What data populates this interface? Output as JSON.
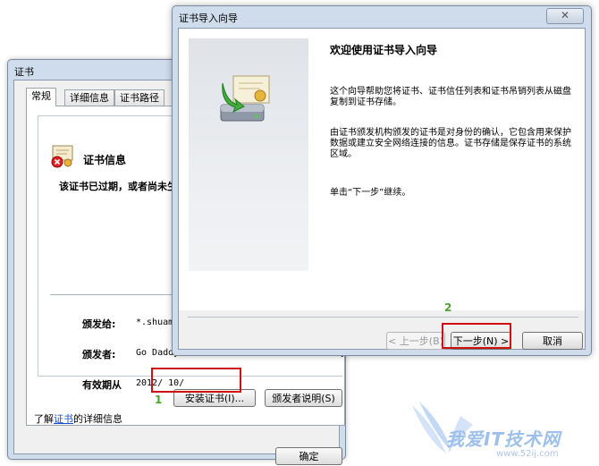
{
  "cert_dialog": {
    "title": "证书",
    "tabs": [
      "常规",
      "详细信息",
      "证书路径"
    ],
    "info_title": "证书信息",
    "expired_message": "该证书已过期，或者尚未生效。",
    "fields": [
      {
        "label": "颁发给:",
        "value": "*.shuame.com"
      },
      {
        "label": "颁发者:",
        "value": "Go Daddy Secure Certification Authority"
      },
      {
        "label": "有效期从",
        "value": "2012/ 10/"
      }
    ],
    "install_button": "安装证书(I)...",
    "issuer_button": "颁发者说明(S)",
    "learn_prefix": "了解",
    "learn_link": "证书",
    "learn_suffix": "的详细信息",
    "ok_button": "确定"
  },
  "wizard": {
    "title": "证书导入向导",
    "close_symbol": "✕",
    "heading": "欢迎使用证书导入向导",
    "para1": "这个向导帮助您将证书、证书信任列表和证书吊销列表从磁盘复制到证书存储。",
    "para2": "由证书颁发机构颁发的证书是对身份的确认，它包含用来保护数据或建立安全网络连接的信息。证书存储是保存证书的系统区域。",
    "para3": "单击“下一步”继续。",
    "back_button": "< 上一步(B)",
    "next_button": "下一步(N) >",
    "cancel_button": "取消"
  },
  "annotations": {
    "step1": "1",
    "step2": "2",
    "highlight_color": "#d01010",
    "number_color": "#4aa52d"
  },
  "watermark": {
    "text": "我爱IT技术网",
    "url": "www.52ij.com"
  }
}
